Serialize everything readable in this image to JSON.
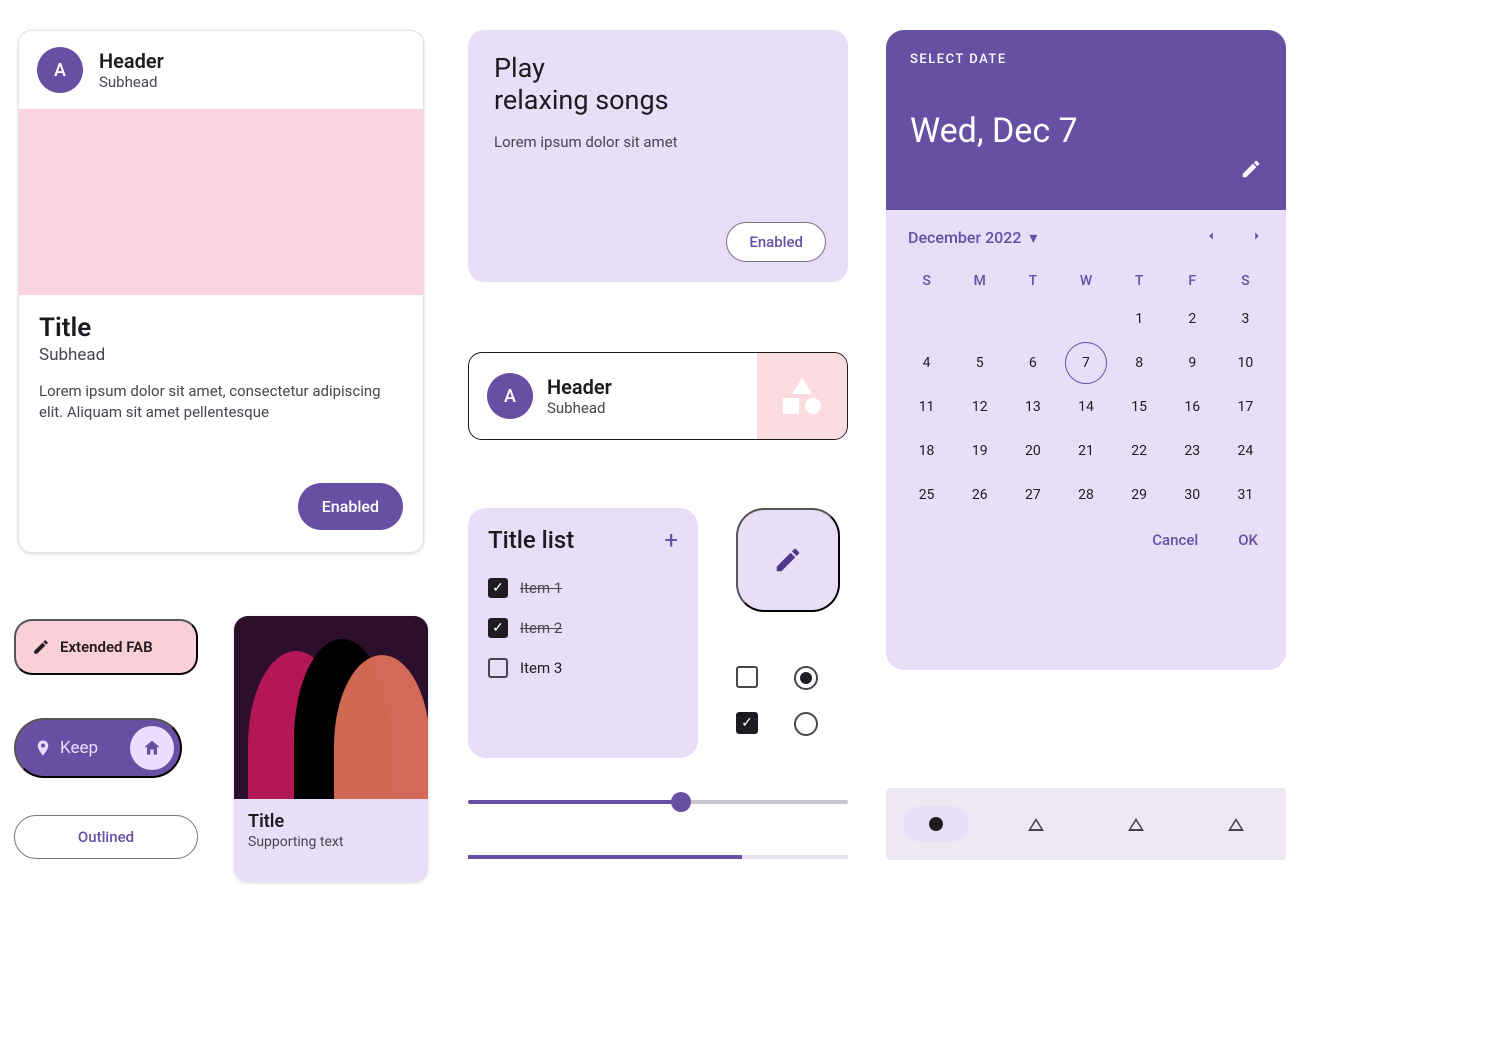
{
  "card1": {
    "avatar": "A",
    "header": "Header",
    "subhead": "Subhead",
    "title": "Title",
    "title_sub": "Subhead",
    "body": "Lorem ipsum dolor sit amet, consectetur adipiscing elit. Aliquam sit amet pellentesque",
    "button": "Enabled"
  },
  "ext_fab": {
    "label": "Extended FAB"
  },
  "keep": {
    "label": "Keep"
  },
  "outlined": {
    "label": "Outlined"
  },
  "imgcard": {
    "title": "Title",
    "sub": "Supporting text"
  },
  "play": {
    "title_l1": "Play",
    "title_l2": "relaxing songs",
    "body": "Lorem ipsum dolor sit amet",
    "button": "Enabled"
  },
  "hdrcard": {
    "avatar": "A",
    "header": "Header",
    "subhead": "Subhead"
  },
  "list": {
    "title": "Title list",
    "items": [
      {
        "label": "Item 1",
        "done": true
      },
      {
        "label": "Item 2",
        "done": true
      },
      {
        "label": "Item 3",
        "done": false
      }
    ]
  },
  "slider": {
    "value": 56
  },
  "progress": {
    "value": 72
  },
  "datepicker": {
    "label": "SELECT DATE",
    "selected_display": "Wed, Dec 7",
    "month_label": "December 2022",
    "weekdays": [
      "S",
      "M",
      "T",
      "W",
      "T",
      "F",
      "S"
    ],
    "leading_blanks": 4,
    "days": 31,
    "selected_day": 7,
    "cancel": "Cancel",
    "ok": "OK"
  },
  "colors": {
    "primary": "#6750a4",
    "surface": "#e8def8",
    "pink": "#fad4de"
  }
}
